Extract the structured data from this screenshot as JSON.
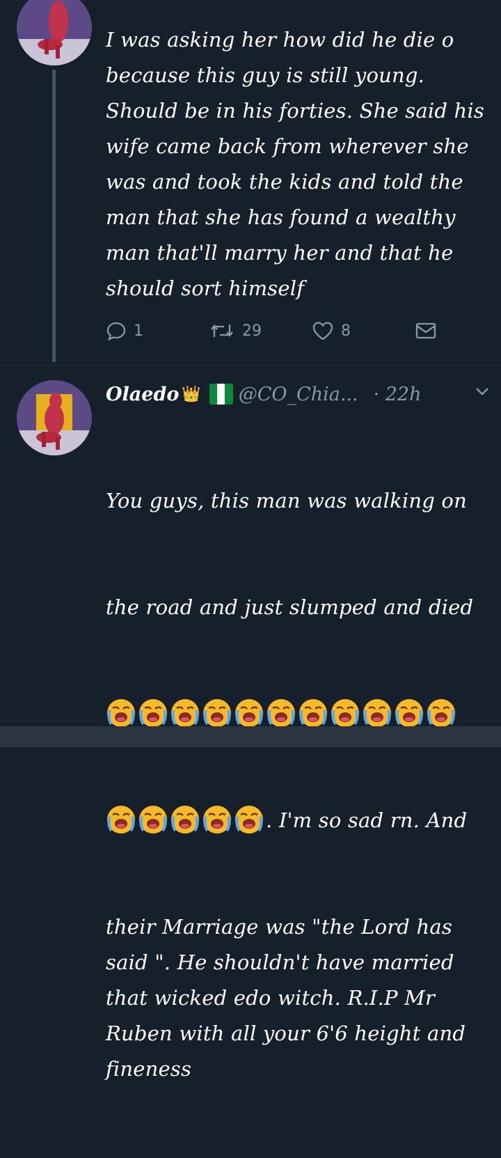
{
  "tweet1": {
    "text": "I was asking her how did he die o\nbecause this guy is still young.\nShould be in his forties. She said his\nwife came back from wherever she\nwas and took the kids and told the\nman that she has found a wealthy\nman that'll marry her and that he\nshould sort himself",
    "replies": "1",
    "retweets": "29",
    "likes": "8"
  },
  "tweet2": {
    "name": "Olaedo",
    "crown": "👑",
    "handle": "@CO_Chia...",
    "time": "· 22h",
    "line1": "You guys, this man was walking on",
    "line2": "the road and just slumped and died",
    "line4_suffix": ". I'm so sad rn. And",
    "rest": "their Marriage was \"the Lord has\nsaid \". He shouldn't have married\nthat wicked edo witch. R.I.P Mr\nRuben with all your 6'6 height and\nfineness",
    "emoji_row1_count": "11",
    "emoji_row2_count": "5"
  },
  "icons": {
    "reply": "reply-icon",
    "retweet": "retweet-icon",
    "like": "heart-icon",
    "dm": "envelope-icon",
    "more": "chevron-down-icon",
    "emoji": "loudly-crying-face-emoji"
  },
  "colors": {
    "background": "#16202b",
    "secondary_text": "#8a98a8",
    "emoji_yellow": "#f7b928"
  }
}
